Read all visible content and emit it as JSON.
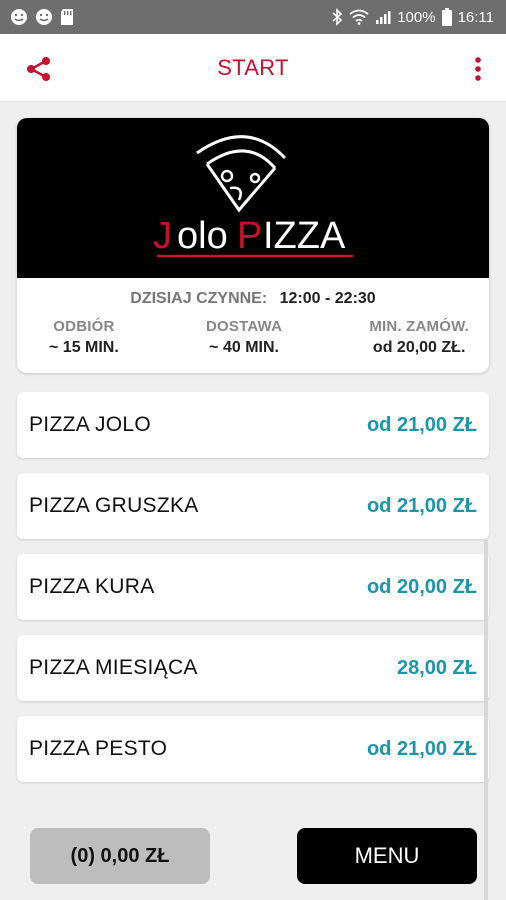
{
  "status_bar": {
    "battery": "100%",
    "time": "16:11"
  },
  "app_bar": {
    "title": "START"
  },
  "restaurant": {
    "logo_text": "JoloPIZZA",
    "hours_label": "DZISIAJ CZYNNE:",
    "hours_value": "12:00 - 22:30",
    "info": [
      {
        "label": "ODBIÓR",
        "value": "~ 15 MIN."
      },
      {
        "label": "DOSTAWA",
        "value": "~ 40 MIN."
      },
      {
        "label": "MIN. ZAMÓW.",
        "value": "od 20,00 ZŁ."
      }
    ]
  },
  "menu_items": [
    {
      "name": "PIZZA JOLO",
      "price": "od 21,00 ZŁ"
    },
    {
      "name": "PIZZA GRUSZKA",
      "price": "od 21,00 ZŁ"
    },
    {
      "name": "PIZZA KURA",
      "price": "od 20,00 ZŁ"
    },
    {
      "name": "PIZZA MIESIĄCA",
      "price": "28,00 ZŁ"
    },
    {
      "name": "PIZZA PESTO",
      "price": "od 21,00 ZŁ"
    }
  ],
  "bottom": {
    "cart_label": "(0) 0,00 ZŁ",
    "menu_label": "MENU"
  },
  "colors": {
    "accent_red": "#c8102e",
    "price_teal": "#1b96a8"
  }
}
